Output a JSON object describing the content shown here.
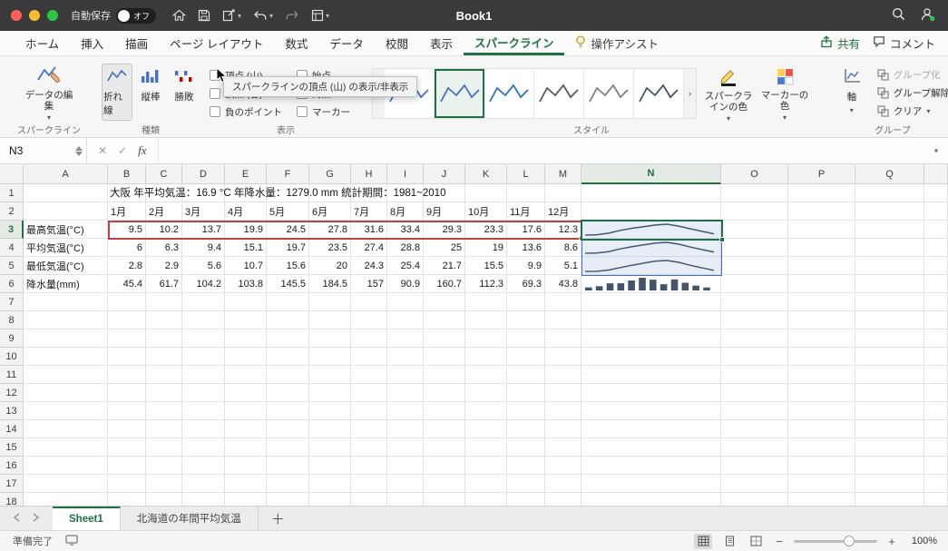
{
  "colors": {
    "accent_green": "#1e7145",
    "sparkline_blue": "#44546a",
    "source_range_red": "#b84442",
    "selection_blue": "#4472c4"
  },
  "titlebar": {
    "autosave_label": "自動保存",
    "autosave_state": "オフ",
    "title": "Book1"
  },
  "ribbon_tabs": {
    "tabs": [
      "ホーム",
      "挿入",
      "描画",
      "ページ レイアウト",
      "数式",
      "データ",
      "校閲",
      "表示",
      "スパークライン"
    ],
    "active": "スパークライン",
    "assist_label": "操作アシスト",
    "share_label": "共有",
    "comments_label": "コメント"
  },
  "ribbon": {
    "sparkline_group": {
      "label": "スパークライン",
      "edit_data_label": "データの編集"
    },
    "type_group": {
      "label": "種類",
      "items": [
        "折れ線",
        "縦棒",
        "勝敗"
      ],
      "selected": "折れ線"
    },
    "show_group": {
      "label": "表示",
      "checkboxes": [
        {
          "label": "頂点 (山)",
          "checked": false
        },
        {
          "label": "始点",
          "checked": false
        },
        {
          "label": "頂点 (谷)",
          "checked": false
        },
        {
          "label": "終点",
          "checked": false
        },
        {
          "label": "負のポイント",
          "checked": false
        },
        {
          "label": "マーカー",
          "checked": false
        }
      ]
    },
    "style_group": {
      "label": "スタイル",
      "styles": [
        {
          "color": "#4472c4"
        },
        {
          "color": "#4472c4"
        },
        {
          "color": "#2e75b6"
        },
        {
          "color": "#595959"
        },
        {
          "color": "#808080"
        },
        {
          "color": "#44546a"
        }
      ],
      "selected_index": 1,
      "sparkline_color_label": "スパークラインの色",
      "marker_color_label": "マーカーの色"
    },
    "group_group": {
      "label": "グループ",
      "axis_label": "軸",
      "items": [
        {
          "label": "グループ化",
          "disabled": true
        },
        {
          "label": "グループ解除",
          "disabled": false
        },
        {
          "label": "クリア",
          "disabled": false,
          "chevron": true
        }
      ]
    },
    "tooltip": "スパークラインの頂点 (山) の表示/非表示"
  },
  "formula_bar": {
    "name_box": "N3",
    "fx_label": "fx"
  },
  "sheet": {
    "columns": [
      "A",
      "B",
      "C",
      "D",
      "E",
      "F",
      "G",
      "H",
      "I",
      "J",
      "K",
      "L",
      "M",
      "N",
      "O",
      "P",
      "Q"
    ],
    "visible_rows": 18,
    "selected_cell": "N3",
    "title_text": "大阪 年平均気温：16.9 °C 年降水量：1279.0 mm 統計期間：1981~2010",
    "months": [
      "1月",
      "2月",
      "3月",
      "4月",
      "5月",
      "6月",
      "7月",
      "8月",
      "9月",
      "10月",
      "11月",
      "12月"
    ],
    "rows": [
      {
        "label": "最高気温(°C)",
        "values": [
          9.5,
          10.2,
          13.7,
          19.9,
          24.5,
          27.8,
          31.6,
          33.4,
          29.3,
          23.3,
          17.6,
          12.3
        ],
        "sparkline": "line"
      },
      {
        "label": "平均気温(°C)",
        "values": [
          6,
          6.3,
          9.4,
          15.1,
          19.7,
          23.5,
          27.4,
          28.8,
          25,
          19,
          13.6,
          8.6
        ],
        "sparkline": "line"
      },
      {
        "label": "最低気温(°C)",
        "values": [
          2.8,
          2.9,
          5.6,
          10.7,
          15.6,
          20,
          24.3,
          25.4,
          21.7,
          15.5,
          9.9,
          5.1
        ],
        "sparkline": "line"
      },
      {
        "label": "降水量(mm)",
        "values": [
          45.4,
          61.7,
          104.2,
          103.8,
          145.5,
          184.5,
          157,
          90.9,
          160.7,
          112.3,
          69.3,
          43.8
        ],
        "sparkline": "column"
      }
    ]
  },
  "sheet_tabs": {
    "tabs": [
      {
        "label": "Sheet1",
        "active": true
      },
      {
        "label": "北海道の年間平均気温",
        "active": false
      }
    ]
  },
  "status_bar": {
    "ready_label": "準備完了",
    "zoom": "100%"
  }
}
